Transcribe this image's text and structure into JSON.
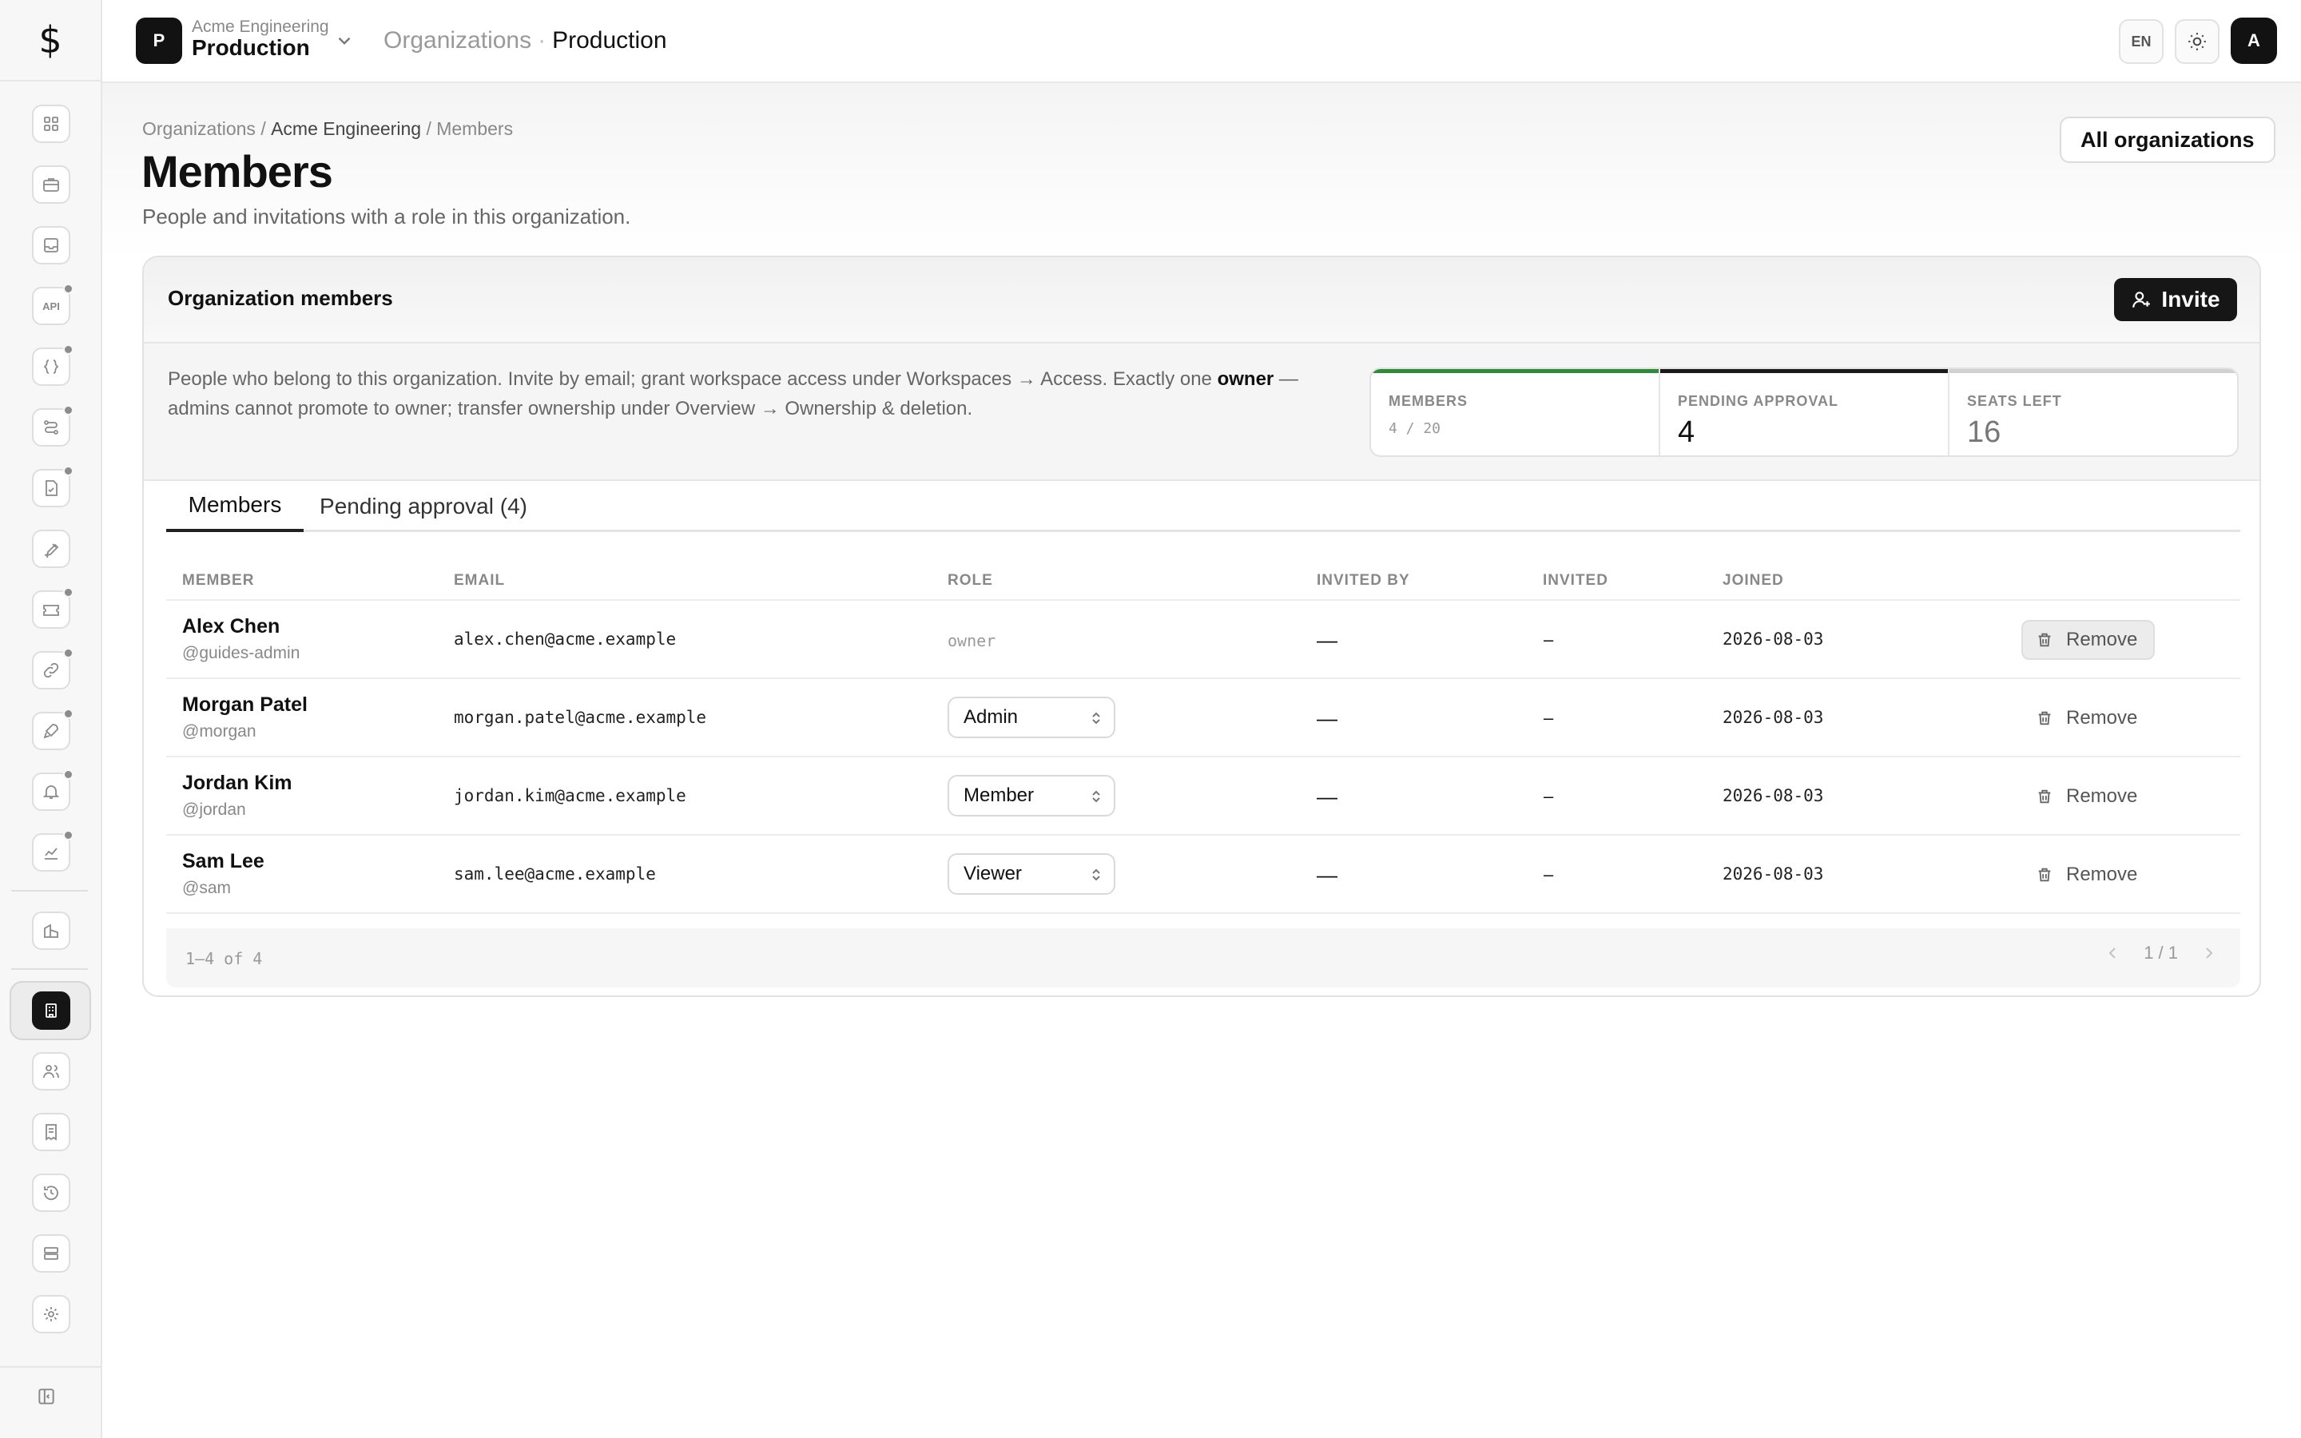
{
  "app": {
    "logo_glyph": "$"
  },
  "sidebar": {
    "items": [
      {
        "icon": "dashboard-icon",
        "dot": false
      },
      {
        "icon": "briefcase-icon",
        "dot": false
      },
      {
        "icon": "inbox-icon",
        "dot": false
      },
      {
        "icon": "api-icon",
        "dot": true,
        "text": "API"
      },
      {
        "icon": "braces-icon",
        "dot": true
      },
      {
        "icon": "workflow-icon",
        "dot": true
      },
      {
        "icon": "document-check-icon",
        "dot": true
      },
      {
        "icon": "brush-icon",
        "dot": false
      },
      {
        "icon": "ticket-icon",
        "dot": true
      },
      {
        "icon": "link-icon",
        "dot": true
      },
      {
        "icon": "rocket-icon",
        "dot": true
      },
      {
        "icon": "bell-icon",
        "dot": true
      },
      {
        "icon": "chart-icon",
        "dot": true
      },
      {
        "icon": "buildings-icon",
        "dot": false
      },
      {
        "icon": "organization-icon",
        "dot": false,
        "active": true
      },
      {
        "icon": "users-icon",
        "dot": false
      },
      {
        "icon": "receipt-icon",
        "dot": false
      },
      {
        "icon": "history-icon",
        "dot": false
      },
      {
        "icon": "server-icon",
        "dot": false
      },
      {
        "icon": "gear-icon",
        "dot": false
      }
    ]
  },
  "topbar": {
    "workspace_initial": "P",
    "org_name": "Acme Engineering",
    "workspace_name": "Production",
    "crumb_root": "Organizations",
    "crumb_sep": "·",
    "crumb_current": "Production",
    "lang": "EN",
    "user_initial": "A"
  },
  "page": {
    "breadcrumb": {
      "root": "Organizations",
      "org": "Acme Engineering",
      "current": "Members",
      "sep": "/"
    },
    "title": "Members",
    "subtitle": "People and invitations with a role in this organization.",
    "all_orgs_label": "All organizations"
  },
  "card": {
    "title": "Organization members",
    "invite_label": "Invite",
    "info": {
      "part1": "People who belong to this organization. Invite by email; grant workspace access under Workspaces → Access. Exactly one ",
      "bold": "owner",
      "part2": " — admins cannot promote to owner; transfer ownership under Overview → Ownership & deletion."
    },
    "stats": [
      {
        "label": "MEMBERS",
        "value": "4 / 20",
        "bar_color": "#2f8a3a"
      },
      {
        "label": "PENDING APPROVAL",
        "value": "4",
        "bar_color": "#1a1a1a"
      },
      {
        "label": "SEATS LEFT",
        "value": "16",
        "bar_color": "#d0d0d0"
      }
    ],
    "tabs": [
      {
        "label": "Members",
        "active": true
      },
      {
        "label": "Pending approval (4)",
        "active": false
      }
    ],
    "columns": [
      "MEMBER",
      "EMAIL",
      "ROLE",
      "INVITED BY",
      "INVITED",
      "JOINED"
    ],
    "rows": [
      {
        "name": "Alex Chen",
        "handle": "@guides-admin",
        "email": "alex.chen@acme.example",
        "role": "owner",
        "role_editable": false,
        "invited_by": "—",
        "invited": "–",
        "joined": "2026-08-03",
        "remove_label": "Remove"
      },
      {
        "name": "Morgan Patel",
        "handle": "@morgan",
        "email": "morgan.patel@acme.example",
        "role": "Admin",
        "role_editable": true,
        "invited_by": "—",
        "invited": "–",
        "joined": "2026-08-03",
        "remove_label": "Remove"
      },
      {
        "name": "Jordan Kim",
        "handle": "@jordan",
        "email": "jordan.kim@acme.example",
        "role": "Member",
        "role_editable": true,
        "invited_by": "—",
        "invited": "–",
        "joined": "2026-08-03",
        "remove_label": "Remove"
      },
      {
        "name": "Sam Lee",
        "handle": "@sam",
        "email": "sam.lee@acme.example",
        "role": "Viewer",
        "role_editable": true,
        "invited_by": "—",
        "invited": "–",
        "joined": "2026-08-03",
        "remove_label": "Remove"
      }
    ],
    "footer": {
      "range": "1–4 of 4",
      "page": "1 / 1"
    }
  }
}
